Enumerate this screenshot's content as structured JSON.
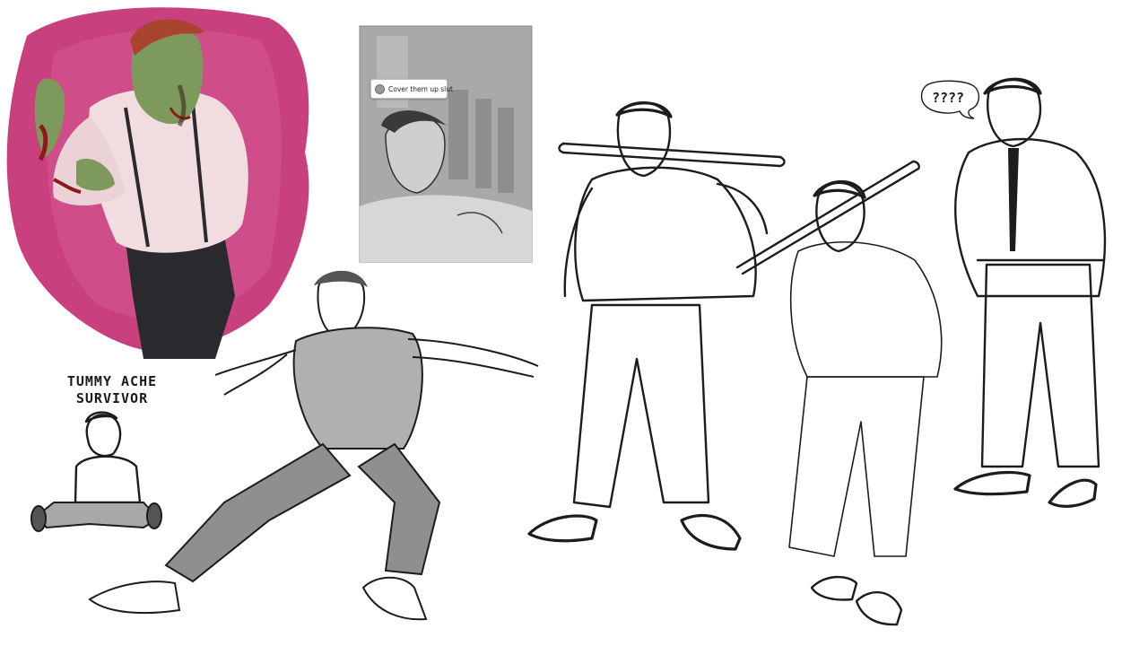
{
  "captions": {
    "tummy_line1": "TUMMY ACHE",
    "tummy_line2": "SURVIVOR",
    "question_marks": "????"
  },
  "comment": {
    "text": "Cover them up slut"
  },
  "colors": {
    "magenta_background": "#c8407e",
    "skin_green": "#7d9a5c",
    "hair_red": "#a8442e",
    "shirt_pink": "#f1dde0",
    "trousers_dark": "#2a2a2e",
    "panel_grey": "#a9a9a9",
    "ink": "#1c1c1c"
  }
}
